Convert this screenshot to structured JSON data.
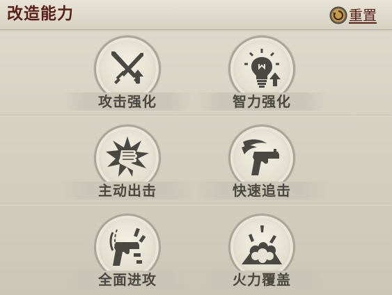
{
  "header": {
    "title": "改造能力",
    "reset_label": "重置"
  },
  "skills": [
    {
      "label": "攻击强化",
      "icon": "swords-up-icon"
    },
    {
      "label": "智力强化",
      "icon": "lightbulb-up-icon"
    },
    {
      "label": "主动出击",
      "icon": "fist-burst-icon"
    },
    {
      "label": "快速追击",
      "icon": "quick-draw-pistol-icon"
    },
    {
      "label": "全面进攻",
      "icon": "rapid-fire-pistol-icon"
    },
    {
      "label": "火力覆盖",
      "icon": "explosion-barrage-icon"
    }
  ],
  "colors": {
    "title": "#5a1f16",
    "label": "#4a4740",
    "icon": "#4a4842",
    "background": "#d4d0c0"
  }
}
